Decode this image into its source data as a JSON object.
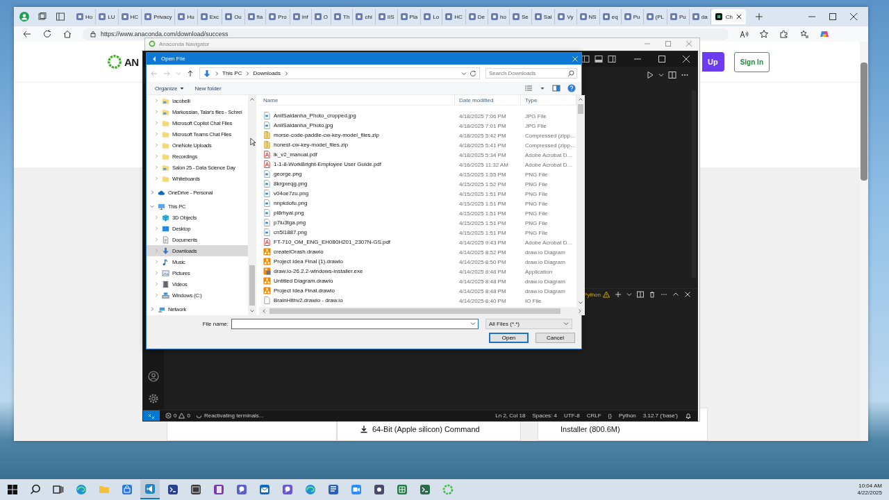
{
  "browser": {
    "tabs": [
      {
        "label": "Ho",
        "selected": false
      },
      {
        "label": "LU",
        "selected": false
      },
      {
        "label": "HC",
        "selected": false
      },
      {
        "label": "Privacy",
        "selected": false
      },
      {
        "label": "Hu",
        "selected": false
      },
      {
        "label": "Exc",
        "selected": false
      },
      {
        "label": "Ou",
        "selected": false
      },
      {
        "label": "fia",
        "selected": false
      },
      {
        "label": "Pro",
        "selected": false
      },
      {
        "label": "Inf",
        "selected": false
      },
      {
        "label": "O",
        "selected": false
      },
      {
        "label": "Th",
        "selected": false
      },
      {
        "label": "chi",
        "selected": false
      },
      {
        "label": "IIS",
        "selected": false
      },
      {
        "label": "Pla",
        "selected": false
      },
      {
        "label": "Lo",
        "selected": false
      },
      {
        "label": "HC",
        "selected": false
      },
      {
        "label": "De",
        "selected": false
      },
      {
        "label": "ho",
        "selected": false
      },
      {
        "label": "Se",
        "selected": false
      },
      {
        "label": "Sal",
        "selected": false
      },
      {
        "label": "Vy",
        "selected": false
      },
      {
        "label": "NS",
        "selected": false
      },
      {
        "label": "eq",
        "selected": false
      },
      {
        "label": "Pu",
        "selected": false
      },
      {
        "label": "(PL",
        "selected": false
      },
      {
        "label": "Pu",
        "selected": false
      },
      {
        "label": "da",
        "selected": false
      },
      {
        "label": "Ch",
        "selected": true
      }
    ],
    "url": "https://www.anaconda.com/download/success",
    "page": {
      "logo_text": "AN",
      "signup_label": "Up",
      "signin_label": "Sign In",
      "cards": [
        {
          "kind": "blank"
        },
        {
          "kind": "download",
          "label": "64-Bit (Apple silicon) Command"
        },
        {
          "kind": "plain",
          "label": "Installer (800.6M)"
        }
      ]
    }
  },
  "navigator": {
    "title": "Anaconda Navigator"
  },
  "vscode": {
    "terminal_tab": "Python",
    "status": {
      "errors": "0",
      "warnings": "0",
      "message": "Reactivating terminals...",
      "items": [
        "Ln 2, Col 18",
        "Spaces: 4",
        "UTF-8",
        "CRLF",
        "{}",
        "Python",
        "3.12.7 ('base')"
      ]
    }
  },
  "open_file_dialog": {
    "title": "Open File",
    "path": [
      "This PC",
      "Downloads"
    ],
    "search_placeholder": "Search Downloads",
    "toolbar": [
      "Organize",
      "New folder"
    ],
    "nav": {
      "group": [
        {
          "label": "Iacobelli",
          "kind": "shared",
          "selected": false
        },
        {
          "label": "Markossian, Talar's files - Schrei",
          "kind": "shared",
          "selected": false
        },
        {
          "label": "Microsoft Copilot Chat Files",
          "kind": "folder",
          "selected": false
        },
        {
          "label": "Microsoft Teams Chat Files",
          "kind": "folder",
          "selected": false
        },
        {
          "label": "OneNote Uploads",
          "kind": "folder",
          "selected": false
        },
        {
          "label": "Recordings",
          "kind": "folder",
          "selected": false
        },
        {
          "label": "Salon 25 - Data Science Day",
          "kind": "shared",
          "selected": false
        },
        {
          "label": "Whiteboards",
          "kind": "folder",
          "selected": false
        }
      ],
      "roots": [
        {
          "label": "OneDrive - Personal",
          "kind": "cloud",
          "expanded": false,
          "selected": false
        },
        {
          "label": "This PC",
          "kind": "pc",
          "expanded": true,
          "selected": false,
          "children": [
            {
              "label": "3D Objects",
              "kind": "cube",
              "selected": false
            },
            {
              "label": "Desktop",
              "kind": "desktop",
              "selected": false
            },
            {
              "label": "Documents",
              "kind": "documents",
              "selected": false
            },
            {
              "label": "Downloads",
              "kind": "download",
              "selected": true
            },
            {
              "label": "Music",
              "kind": "music",
              "selected": false
            },
            {
              "label": "Pictures",
              "kind": "pictures",
              "selected": false
            },
            {
              "label": "Videos",
              "kind": "videos",
              "selected": false
            },
            {
              "label": "Windows (C:)",
              "kind": "drive",
              "selected": false
            }
          ]
        },
        {
          "label": "Network",
          "kind": "network",
          "expanded": false,
          "selected": false
        }
      ]
    },
    "columns": [
      "Name",
      "Date modified",
      "Type"
    ],
    "rows": [
      {
        "name": "AnilSaldanha_Photo_cropped.jpg",
        "date": "4/18/2025 7:06 PM",
        "type": "JPG File",
        "kind": "image"
      },
      {
        "name": "AnilSaldanha_Photo.jpg",
        "date": "4/18/2025 7:01 PM",
        "type": "JPG File",
        "kind": "image"
      },
      {
        "name": "morse-code-paddle-cw-key-model_files.zip",
        "date": "4/18/2025 5:42 PM",
        "type": "Compressed (zipp…",
        "kind": "zip"
      },
      {
        "name": "honest-cw-key-model_files.zip",
        "date": "4/18/2025 5:41 PM",
        "type": "Compressed (zipp…",
        "kind": "zip"
      },
      {
        "name": "ik_v2_manual.pdf",
        "date": "4/18/2025 5:34 PM",
        "type": "Adobe Acrobat D…",
        "kind": "pdf"
      },
      {
        "name": "1-1-8-WorkBright-Employee User Guide.pdf",
        "date": "4/16/2025 11:32 AM",
        "type": "Adobe Acrobat D…",
        "kind": "pdf"
      },
      {
        "name": "george.png",
        "date": "4/15/2025 1:55 PM",
        "type": "PNG File",
        "kind": "image"
      },
      {
        "name": "8krgxeqg.png",
        "date": "4/15/2025 1:52 PM",
        "type": "PNG File",
        "kind": "image"
      },
      {
        "name": "v04oe7zu.png",
        "date": "4/15/2025 1:51 PM",
        "type": "PNG File",
        "kind": "image"
      },
      {
        "name": "nnpkdofu.png",
        "date": "4/15/2025 1:51 PM",
        "type": "PNG File",
        "kind": "image"
      },
      {
        "name": "pl8rhyai.png",
        "date": "4/15/2025 1:51 PM",
        "type": "PNG File",
        "kind": "image"
      },
      {
        "name": "p7lu3tga.png",
        "date": "4/15/2025 1:51 PM",
        "type": "PNG File",
        "kind": "image"
      },
      {
        "name": "cn5l1887.png",
        "date": "4/15/2025 1:51 PM",
        "type": "PNG File",
        "kind": "image"
      },
      {
        "name": "FT-710_OM_ENG_EH080H201_2307N-GS.pdf",
        "date": "4/14/2025 9:43 PM",
        "type": "Adobe Acrobat D…",
        "kind": "pdf"
      },
      {
        "name": "createlOrash.drawio",
        "date": "4/14/2025 8:52 PM",
        "type": "draw.io Diagram",
        "kind": "diagram"
      },
      {
        "name": "Project Idea Final (1).drawio",
        "date": "4/14/2025 8:50 PM",
        "type": "draw.io Diagram",
        "kind": "diagram"
      },
      {
        "name": "draw.io-26.2.2-windows-installer.exe",
        "date": "4/14/2025 8:48 PM",
        "type": "Application",
        "kind": "installer"
      },
      {
        "name": "Untitled Diagram.drawio",
        "date": "4/14/2025 8:48 PM",
        "type": "draw.io Diagram",
        "kind": "diagram"
      },
      {
        "name": "Project Idea Final.drawio",
        "date": "4/14/2025 8:48 PM",
        "type": "draw.io Diagram",
        "kind": "diagram"
      },
      {
        "name": "BrainHlthv2.drawio - draw.io",
        "date": "4/14/2025 8:40 PM",
        "type": "IO File",
        "kind": "file"
      }
    ],
    "file_name_label": "File name:",
    "file_name_focused": true,
    "filter": "All Files (*.*)",
    "buttons": [
      "Open",
      "Cancel"
    ]
  },
  "taskbar": {
    "apps": [
      {
        "kind": "browser",
        "selected": false
      },
      {
        "kind": "folder",
        "selected": false
      },
      {
        "kind": "store",
        "selected": false
      },
      {
        "kind": "editor",
        "selected": true
      },
      {
        "kind": "shell",
        "selected": false
      },
      {
        "kind": "terminal",
        "selected": false
      },
      {
        "kind": "notes",
        "selected": false
      },
      {
        "kind": "chat",
        "selected": false
      },
      {
        "kind": "mail",
        "selected": false
      },
      {
        "kind": "voice",
        "selected": false
      },
      {
        "kind": "browser",
        "selected": false
      },
      {
        "kind": "document",
        "selected": false
      },
      {
        "kind": "video",
        "selected": false
      },
      {
        "kind": "tool",
        "selected": false
      },
      {
        "kind": "sheet",
        "selected": false
      },
      {
        "kind": "prompt",
        "selected": false
      },
      {
        "kind": "ring",
        "selected": false
      }
    ],
    "time": "10:04 AM",
    "date": "4/22/2025"
  }
}
